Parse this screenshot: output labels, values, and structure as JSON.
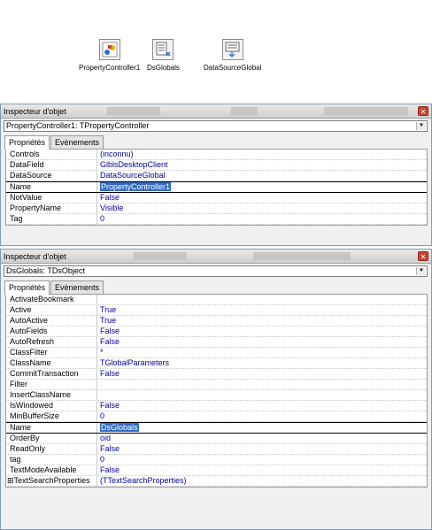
{
  "components": [
    {
      "name": "PropertyController1",
      "icon": "property-controller-icon"
    },
    {
      "name": "DsGlobals",
      "icon": "dataset-icon"
    },
    {
      "name": "DataSourceGlobal",
      "icon": "datasource-icon"
    }
  ],
  "inspector1": {
    "title": "Inspecteur d'objet",
    "selector": "PropertyController1: TPropertyController",
    "tabs": [
      "Propriétés",
      "Evènements"
    ],
    "rows": [
      {
        "name": "Controls",
        "value": "(inconnu)"
      },
      {
        "name": "DataField",
        "value": "GlblsDesktopClient"
      },
      {
        "name": "DataSource",
        "value": "DataSourceGlobal"
      },
      {
        "name": "Name",
        "value": "PropertyController1",
        "selected": true
      },
      {
        "name": "NotValue",
        "value": "False"
      },
      {
        "name": "PropertyName",
        "value": "Visible"
      },
      {
        "name": "Tag",
        "value": "0"
      }
    ]
  },
  "inspector2": {
    "title": "Inspecteur d'objet",
    "selector": "DsGlobals: TDsObject",
    "tabs": [
      "Propriétés",
      "Evènements"
    ],
    "rows": [
      {
        "name": "ActivateBookmark",
        "value": ""
      },
      {
        "name": "Active",
        "value": "True"
      },
      {
        "name": "AutoActive",
        "value": "True"
      },
      {
        "name": "AutoFields",
        "value": "False"
      },
      {
        "name": "AutoRefresh",
        "value": "False"
      },
      {
        "name": "ClassFilter",
        "value": "*"
      },
      {
        "name": "ClassName",
        "value": "TGlobalParameters"
      },
      {
        "name": "CommitTransaction",
        "value": "False"
      },
      {
        "name": "Filter",
        "value": ""
      },
      {
        "name": "InsertClassName",
        "value": ""
      },
      {
        "name": "IsWindowed",
        "value": "False"
      },
      {
        "name": "MinBufferSize",
        "value": "0"
      },
      {
        "name": "Name",
        "value": "DsGlobals",
        "selected": true
      },
      {
        "name": "OrderBy",
        "value": "oid"
      },
      {
        "name": "ReadOnly",
        "value": "False"
      },
      {
        "name": "tag",
        "value": "0"
      },
      {
        "name": "TextModeAvailable",
        "value": "False"
      },
      {
        "name": "⊞TextSearchProperties",
        "value": "(TTextSearchProperties)"
      }
    ]
  },
  "colors": {
    "value_text": "#0000a0",
    "selection": "#316ac5",
    "close": "#c9462f"
  }
}
